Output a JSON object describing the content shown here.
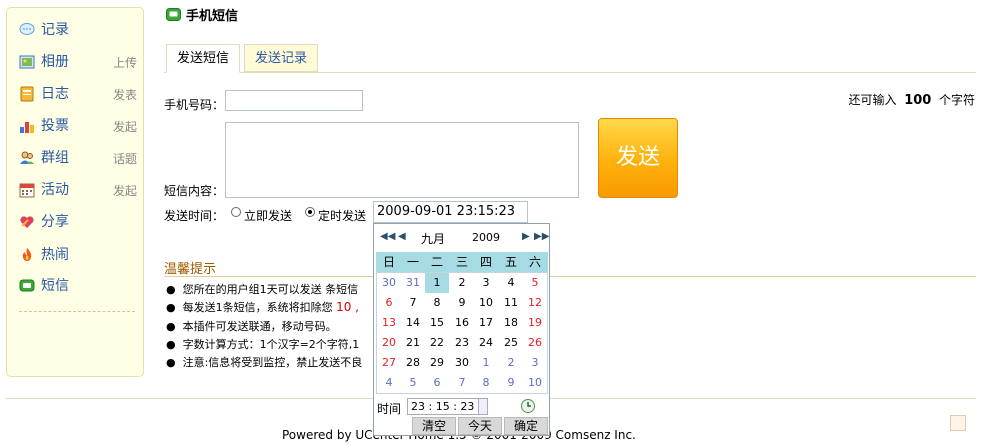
{
  "sidebar": {
    "items": [
      {
        "label": "记录",
        "sub": "",
        "icon": "speech-bubble-icon"
      },
      {
        "label": "相册",
        "sub": "上传",
        "icon": "photo-icon"
      },
      {
        "label": "日志",
        "sub": "发表",
        "icon": "journal-icon"
      },
      {
        "label": "投票",
        "sub": "发起",
        "icon": "bar-chart-icon"
      },
      {
        "label": "群组",
        "sub": "话题",
        "icon": "group-icon"
      },
      {
        "label": "活动",
        "sub": "发起",
        "icon": "calendar-icon"
      },
      {
        "label": "分享",
        "sub": "",
        "icon": "heart-share-icon"
      },
      {
        "label": "热闹",
        "sub": "",
        "icon": "flame-icon"
      },
      {
        "label": "短信",
        "sub": "",
        "icon": "sms-icon"
      }
    ]
  },
  "page": {
    "title": "手机短信"
  },
  "tabs": [
    {
      "label": "发送短信"
    },
    {
      "label": "发送记录"
    }
  ],
  "form": {
    "phone_label": "手机号码：",
    "content_label": "短信内容：",
    "send_time_label": "发送时间：",
    "option_now": "立即发送",
    "option_scheduled": "定时发送",
    "scheduled_value": "2009-09-01 23:15:23",
    "remaining_prefix": "还可输入",
    "remaining_count": "100",
    "remaining_suffix": "个字符",
    "send_button": "发送"
  },
  "tips": {
    "title": "温馨提示",
    "lines": [
      "您所在的用户组1天可以发送  条短信",
      "每发送1条短信，系统将扣除您",
      "本插件可发送联通，移动号码。",
      "字数计算方式：1个汉字=2个字符,1",
      "注意:信息将受到监控，禁止发送不良"
    ],
    "cost_value": "10 ,"
  },
  "calendar": {
    "month": "九月",
    "year": "2009",
    "weekdays": [
      "日",
      "一",
      "二",
      "三",
      "四",
      "五",
      "六"
    ],
    "days": [
      [
        "30",
        "31",
        "1",
        "2",
        "3",
        "4",
        "5"
      ],
      [
        "6",
        "7",
        "8",
        "9",
        "10",
        "11",
        "12"
      ],
      [
        "13",
        "14",
        "15",
        "16",
        "17",
        "18",
        "19"
      ],
      [
        "20",
        "21",
        "22",
        "23",
        "24",
        "25",
        "26"
      ],
      [
        "27",
        "28",
        "29",
        "30",
        "1",
        "2",
        "3"
      ],
      [
        "4",
        "5",
        "6",
        "7",
        "8",
        "9",
        "10"
      ]
    ],
    "selected_day": "1",
    "time_label": "时间",
    "time_value": "23 : 15 : 23",
    "btn_clear": "清空",
    "btn_today": "今天",
    "btn_ok": "确定"
  },
  "footer": {
    "text": "Powered by UCenter Home 1.5 © 2001-2009 Comsenz Inc."
  },
  "colors": {
    "link_blue": "#2a58a5",
    "send_orange": "#ffb10c",
    "calendar_header": "#a7dbe3",
    "weekend_red": "#e02020",
    "other_month_blue": "#5b6fc2"
  }
}
